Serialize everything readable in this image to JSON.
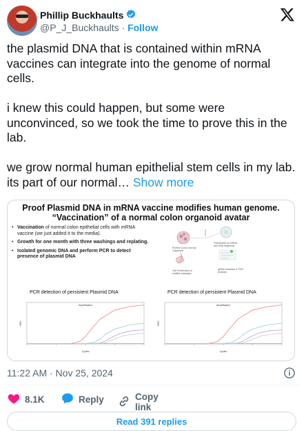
{
  "author": {
    "name": "Phillip Buckhaults",
    "handle": "@P_J_Buckhaults",
    "separator": "·",
    "follow_label": "Follow"
  },
  "tweet": {
    "paragraphs": [
      "the plasmid DNA that is contained within mRNA vaccines can integrate into the genome of normal cells.",
      "i knew this could happen, but some were unconvinced, so we took the time to prove this in the lab.",
      "we grow normal human epithelial stem cells in my lab.  its part of our normal…"
    ],
    "show_more_label": "Show more"
  },
  "media": {
    "title_line1": "Proof Plasmid DNA in mRNA vaccine modifies human genome.",
    "title_line2": "“Vaccination” of a normal colon organoid avatar",
    "bullets": [
      {
        "strong": "Vaccination",
        "text": " of normal colon epithelial cells with mRNA vaccine (we just added it to the media)."
      },
      {
        "strong": "Growth for one month with three washings and replating.",
        "text": ""
      },
      {
        "strong": "Isolated genomic DNA and perform PCR to detect presence of plasmid DNA",
        "text": ""
      }
    ],
    "diagram_labels": [
      "Purified Colon Normal Organoids",
      "Transfected w/ mRNA and DNA fragments",
      "Cell Proliferation & multiple passages",
      "gDNA extraction & PCR Analysis"
    ],
    "chart_left_title": "PCR detection of persistent Plasmid DNA",
    "chart_right_title": "PCR detection of persistent Plasmid DNA"
  },
  "chart_data": [
    {
      "type": "line",
      "title": "Amplification",
      "xlabel": "Cycles",
      "ylabel": "RFU",
      "xlim": [
        0,
        40
      ],
      "series": [
        {
          "values_x": [
            0,
            10,
            15,
            18,
            20,
            22,
            25,
            30,
            35,
            40
          ],
          "values_y": [
            0,
            0,
            0.05,
            0.3,
            0.9,
            1.8,
            3.0,
            4.1,
            4.5,
            4.7
          ],
          "color": "#e8837a"
        },
        {
          "values_x": [
            0,
            10,
            20,
            23,
            25,
            27,
            30,
            35,
            40
          ],
          "values_y": [
            0,
            0,
            0.05,
            0.2,
            0.6,
            1.2,
            1.8,
            2.3,
            2.5
          ],
          "color": "#8ecfcf"
        },
        {
          "values_x": [
            0,
            10,
            20,
            25,
            27,
            29,
            32,
            36,
            40
          ],
          "values_y": [
            0,
            0,
            0.02,
            0.1,
            0.4,
            0.8,
            1.3,
            1.6,
            1.7
          ],
          "color": "#b7a0d6"
        },
        {
          "values_x": [
            0,
            10,
            20,
            26,
            28,
            30,
            33,
            37,
            40
          ],
          "values_y": [
            0,
            0,
            0.02,
            0.08,
            0.3,
            0.6,
            1.0,
            1.2,
            1.3
          ],
          "color": "#c9c9c9"
        }
      ]
    },
    {
      "type": "line",
      "title": "Amplification",
      "xlabel": "Cycles",
      "ylabel": "RFU",
      "xlim": [
        0,
        40
      ],
      "series": [
        {
          "values_x": [
            0,
            10,
            15,
            18,
            20,
            22,
            25,
            30,
            35,
            40
          ],
          "values_y": [
            0,
            0,
            0.05,
            0.3,
            0.9,
            1.8,
            3.0,
            4.1,
            4.5,
            4.7
          ],
          "color": "#e8837a"
        },
        {
          "values_x": [
            0,
            10,
            20,
            23,
            25,
            27,
            30,
            35,
            40
          ],
          "values_y": [
            0,
            0,
            0.05,
            0.2,
            0.6,
            1.2,
            1.8,
            2.3,
            2.5
          ],
          "color": "#8ecfcf"
        },
        {
          "values_x": [
            0,
            10,
            20,
            25,
            27,
            29,
            32,
            36,
            40
          ],
          "values_y": [
            0,
            0,
            0.02,
            0.1,
            0.4,
            0.8,
            1.3,
            1.6,
            1.7
          ],
          "color": "#b7a0d6"
        },
        {
          "values_x": [
            0,
            10,
            20,
            26,
            28,
            30,
            33,
            37,
            40
          ],
          "values_y": [
            0,
            0,
            0.02,
            0.08,
            0.3,
            0.6,
            1.0,
            1.2,
            1.3
          ],
          "color": "#c9c9c9"
        }
      ]
    }
  ],
  "meta": {
    "timestamp": "11:22 AM · Nov 25, 2024"
  },
  "actions": {
    "likes": "8.1K",
    "reply_label": "Reply",
    "copy_link_label": "Copy link",
    "read_replies_label": "Read 391 replies"
  },
  "colors": {
    "accent": "#1d9bf0",
    "like": "#f91880",
    "muted": "#536471"
  }
}
